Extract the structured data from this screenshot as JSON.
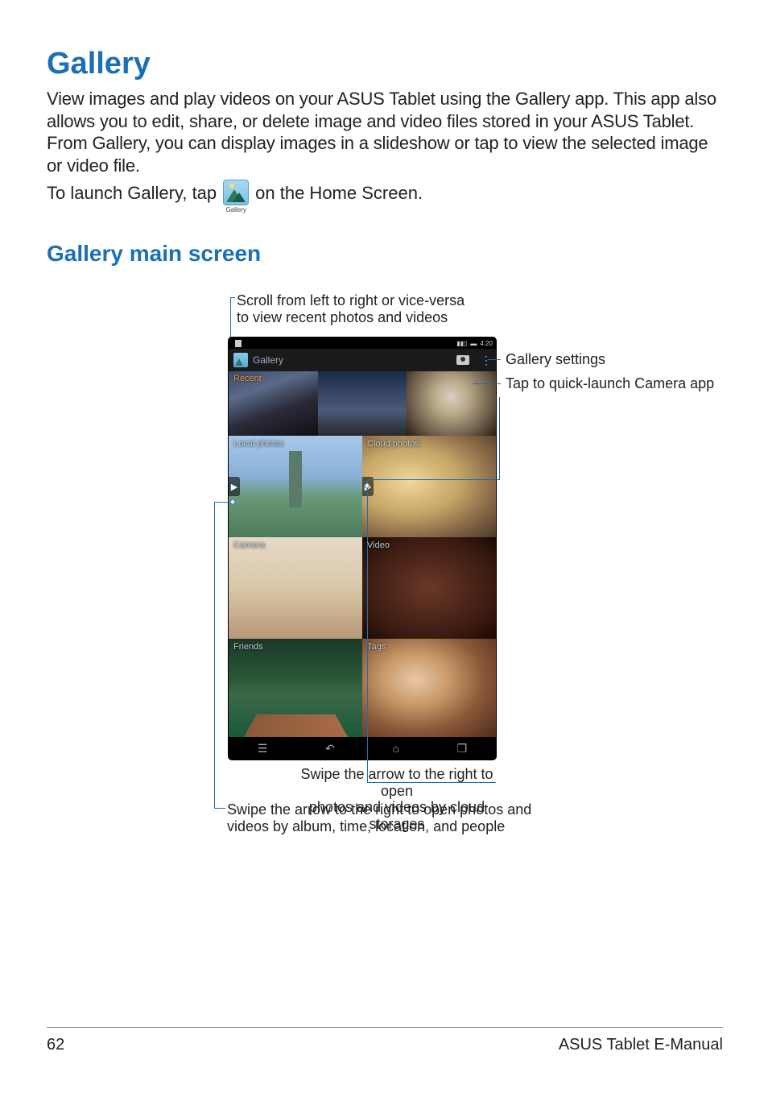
{
  "page": {
    "number": "62",
    "footer_right": "ASUS Tablet E-Manual"
  },
  "headings": {
    "h1": "Gallery",
    "h2": "Gallery main screen"
  },
  "body": {
    "intro": "View images and play videos on your ASUS Tablet using the Gallery app. This app also allows you to edit, share, or delete image and video files stored in your ASUS Tablet. From Gallery, you can display images in a slideshow or tap to view the selected image or video file.",
    "launch_pre": "To launch Gallery, tap",
    "launch_icon_caption": "Gallery",
    "launch_post": "on the Home Screen."
  },
  "callouts": {
    "top": "Scroll from left to right or vice-versa\nto view recent photos and videos",
    "right_settings": "Gallery settings",
    "right_camera": "Tap to quick-launch Camera app",
    "bottom_cloud": "Swipe the arrow to the right to open\nphotos and videos by cloud storages",
    "bottom_album": "Swipe the arrow to the right to open photos and\nvideos by album, time, location, and people"
  },
  "device": {
    "status_time": "4:20",
    "appbar_title": "Gallery",
    "sections": {
      "recent": "Recent",
      "local": "Local photos",
      "cloud": "Cloud photos",
      "camera": "Camera",
      "video": "Video",
      "friends": "Friends",
      "tags": "Tags"
    },
    "nav": {
      "menu_glyph": "☰",
      "back_glyph": "↶",
      "home_glyph": "⌂",
      "recent_glyph": "❐"
    }
  }
}
